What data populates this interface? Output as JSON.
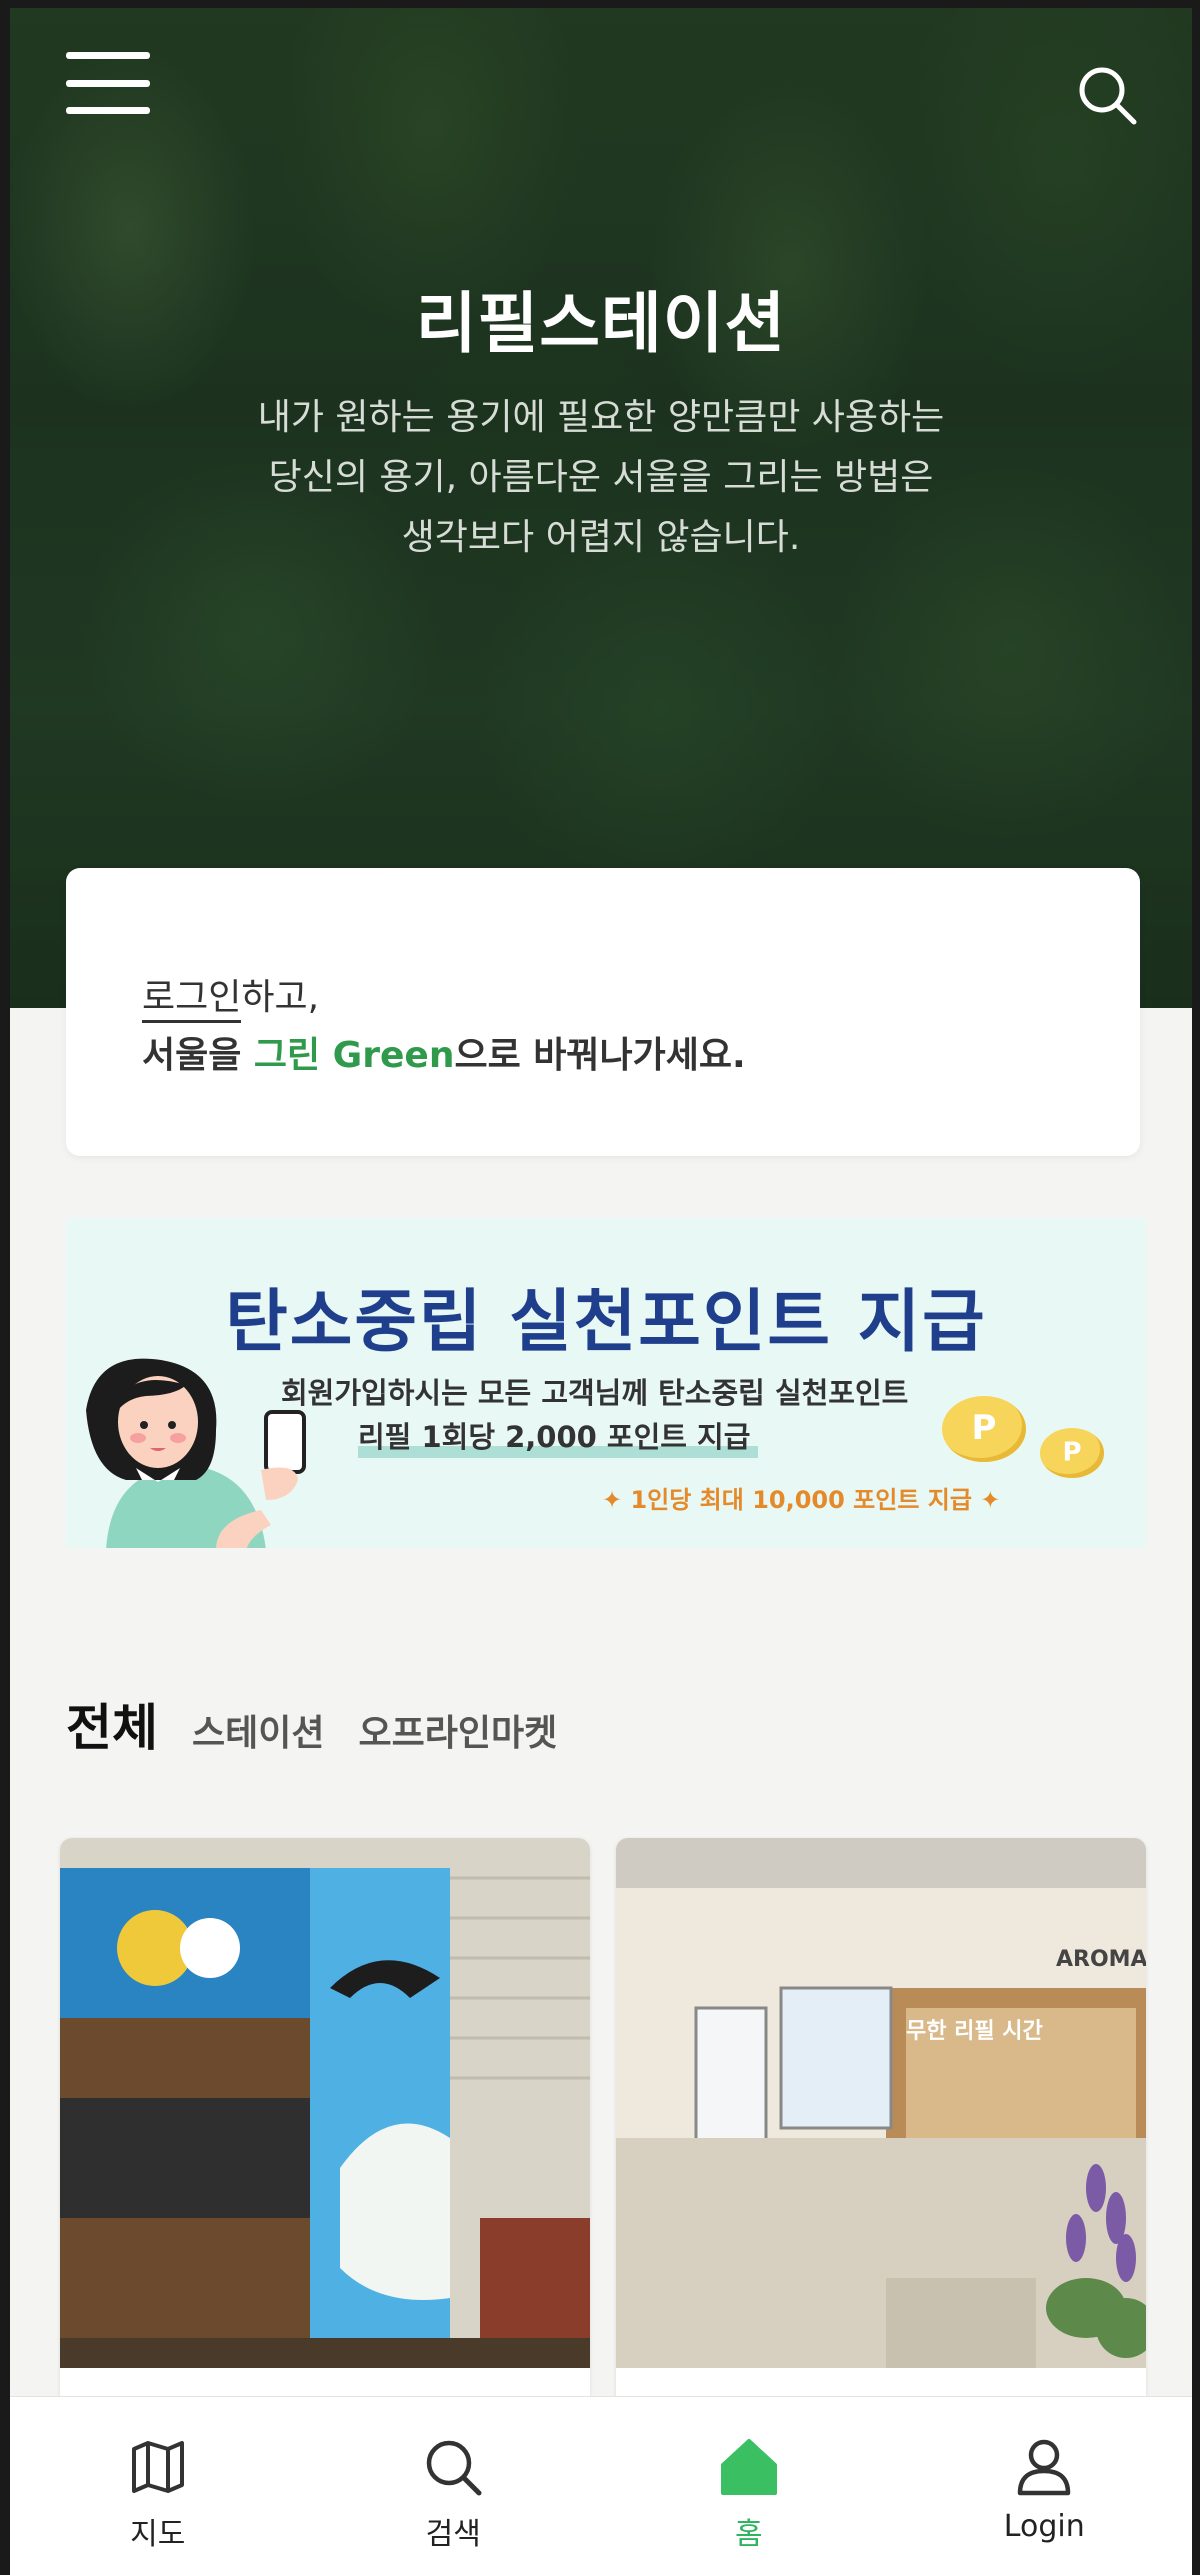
{
  "header": {
    "title": "리필스테이션",
    "subtitle_lines": [
      "내가 원하는 용기에 필요한 양만큼만 사용하는",
      "당신의 용기, 아름다운 서울을 그리는 방법은",
      "생각보다 어렵지 않습니다."
    ]
  },
  "login_card": {
    "login_link": "로그인",
    "line1_rest": "하고,",
    "line2_prefix": "서울을 ",
    "line2_green": "그린 Green",
    "line2_suffix": "으로 바꿔나가세요."
  },
  "banner": {
    "title": "탄소중립 실천포인트 지급",
    "line1": "회원가입하시는 모든 고객님께 탄소중립 실천포인트",
    "line2": "리필 1회당 2,000 포인트 지급",
    "line3": "✦ 1인당 최대 10,000 포인트 지급 ✦",
    "coin_label": "P"
  },
  "tabs": [
    "전체",
    "스테이션",
    "오프라인마켓"
  ],
  "cards": {
    "card2_sign": "AROMA",
    "card2_window_text": "무한 리필 시간"
  },
  "bottom_nav": [
    {
      "label": "지도",
      "icon": "map-icon"
    },
    {
      "label": "검색",
      "icon": "search-icon"
    },
    {
      "label": "홈",
      "icon": "home-icon"
    },
    {
      "label": "Login",
      "icon": "user-icon"
    }
  ],
  "colors": {
    "accent_green": "#2f9a4b",
    "nav_active": "#2fb560",
    "banner_title": "#1f3f8c",
    "banner_point": "#e58a2a"
  }
}
